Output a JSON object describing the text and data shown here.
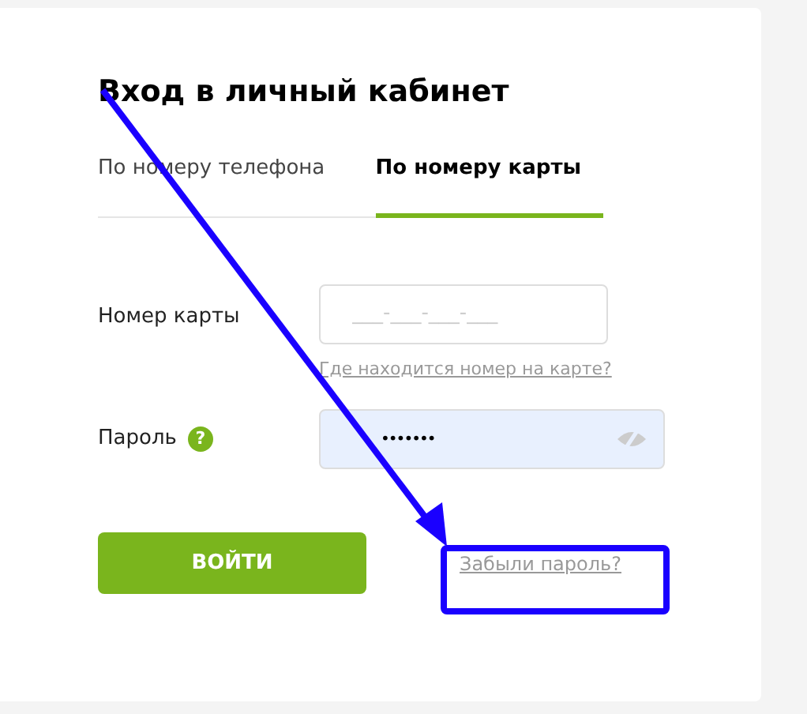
{
  "title": "Вход в личный кабинет",
  "tabs": [
    {
      "label": "По номеру телефона",
      "selected": false
    },
    {
      "label": "По номеру карты",
      "selected": true
    }
  ],
  "card_field": {
    "label": "Номер карты",
    "placeholder": "___-___-___-___",
    "help_link": "Где находится номер на карте?"
  },
  "password_field": {
    "label": "Пароль",
    "help_icon": "?",
    "value": "•••••••"
  },
  "login_button": "ВОЙТИ",
  "forgot_link": "Забыли пароль?"
}
